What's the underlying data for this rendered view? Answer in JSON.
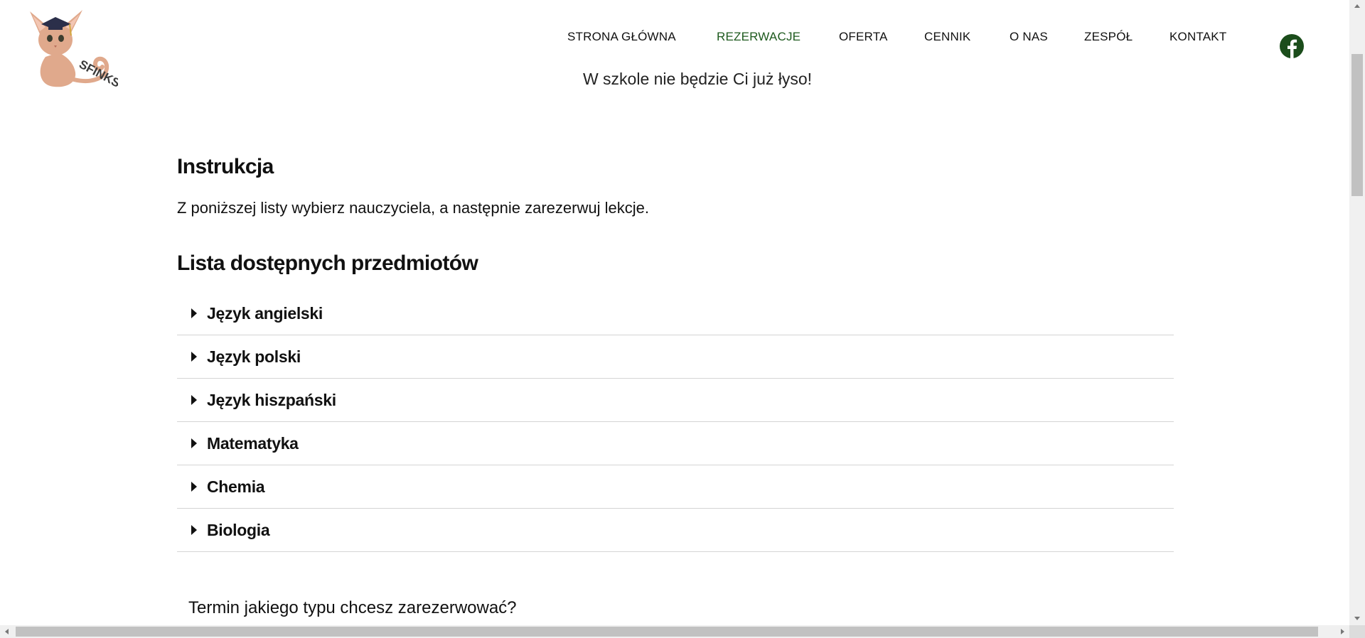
{
  "header": {
    "logo_text": "SFINKS",
    "nav": [
      {
        "label": "STRONA GŁÓWNA",
        "active": false
      },
      {
        "label": "REZERWACJE",
        "active": true
      },
      {
        "label": "OFERTA",
        "active": false
      },
      {
        "label": "CENNIK",
        "active": false
      },
      {
        "label": "O NAS",
        "active": false
      },
      {
        "label": "ZESPÓŁ",
        "active": false
      },
      {
        "label": "KONTAKT",
        "active": false
      }
    ],
    "social_icon": "facebook-icon",
    "tagline": "W szkole nie będzie Ci już łyso!"
  },
  "main": {
    "instruction_title": "Instrukcja",
    "instruction_text": "Z poniższej listy wybierz nauczyciela, a następnie zarezerwuj lekcje.",
    "subjects_title": "Lista dostępnych przedmiotów",
    "subjects": [
      "Język angielski",
      "Język polski",
      "Język hiszpański",
      "Matematyka",
      "Chemia",
      "Biologia"
    ],
    "question": "Termin jakiego typu chcesz zarezerwować?"
  },
  "colors": {
    "active_nav": "#1e5a1e",
    "facebook": "#1b4d1b",
    "logo_cat": "#e0a98c",
    "divider": "#d4d4d4"
  }
}
